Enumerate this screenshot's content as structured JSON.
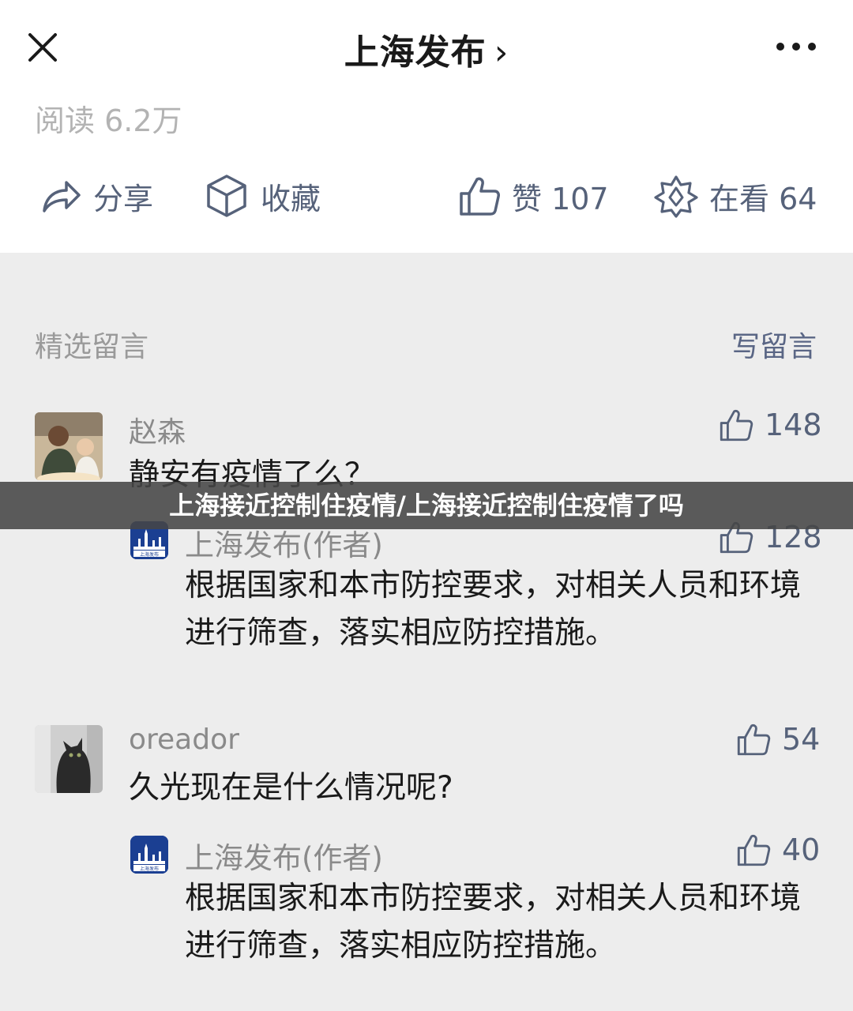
{
  "header": {
    "title": "上海发布",
    "title_chevron": "›"
  },
  "reads": "阅读 6.2万",
  "actions": {
    "share": "分享",
    "favorite": "收藏",
    "like": "赞 107",
    "watching": "在看 64"
  },
  "section": {
    "label": "精选留言",
    "write": "写留言"
  },
  "comments": [
    {
      "user": "赵森",
      "likes": "148",
      "text": "静安有疫情了么？",
      "reply": {
        "author": "上海发布(作者)",
        "likes": "128",
        "text": "根据国家和本市防控要求，对相关人员和环境进行筛查，落实相应防控措施。"
      }
    },
    {
      "user": "oreador",
      "likes": "54",
      "text": "久光现在是什么情况呢?",
      "reply": {
        "author": "上海发布(作者)",
        "likes": "40",
        "text": "根据国家和本市防控要求，对相关人员和环境进行筛查，落实相应防控措施。"
      }
    }
  ],
  "logo_text": "上海发布",
  "banner": "上海接近控制住疫情/上海接近控制住疫情了吗",
  "colors": {
    "accent": "#56627a",
    "muted": "#8a8a8a",
    "background": "#ededed",
    "logo_blue": "#1b3f92"
  }
}
